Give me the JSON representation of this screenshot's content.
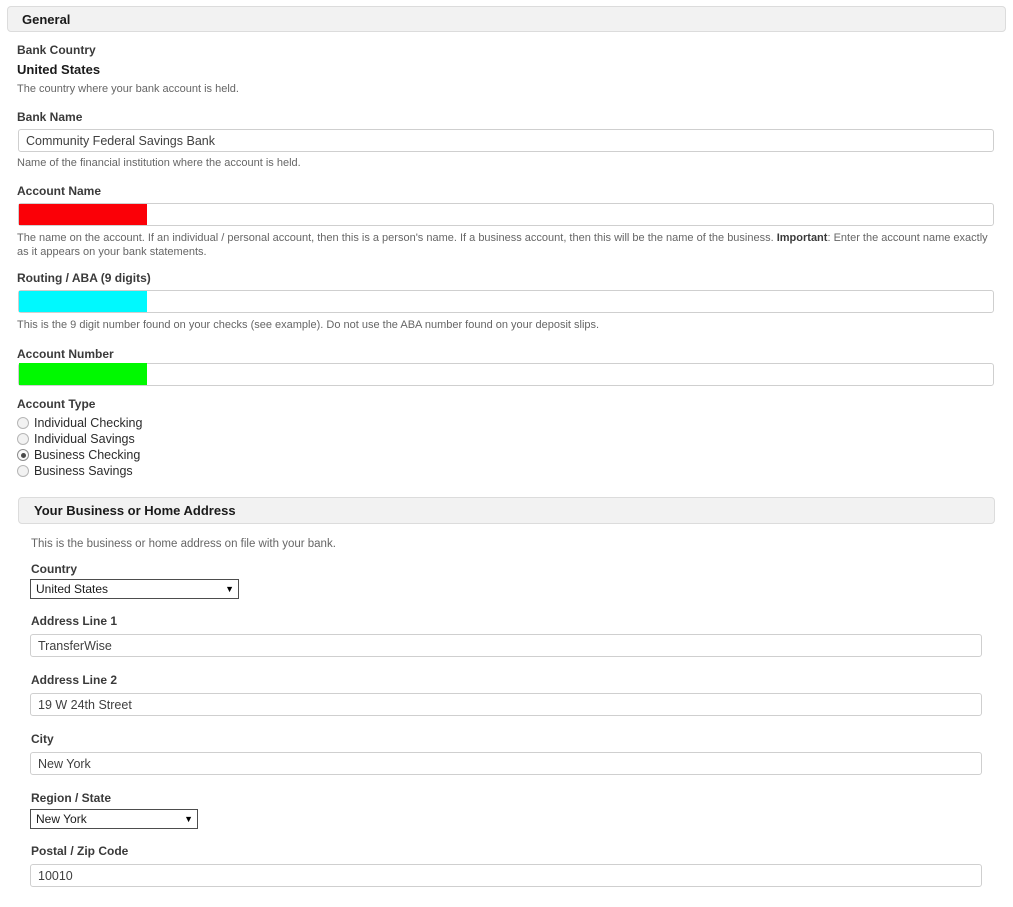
{
  "general_section": {
    "title": "General",
    "bank_country": {
      "label": "Bank Country",
      "value": "United States",
      "help": "The country where your bank account is held."
    },
    "bank_name": {
      "label": "Bank Name",
      "value": "Community Federal Savings Bank",
      "help": "Name of the financial institution where the account is held."
    },
    "account_name": {
      "label": "Account Name",
      "value": "",
      "redaction_color": "#fb0007",
      "help_part1": "The name on the account. If an individual / personal account, then this is a person's name. If a business account, then this will be the name of the business. ",
      "help_bold": "Important",
      "help_part2": ": Enter the account name exactly as it appears on your bank statements."
    },
    "routing_aba": {
      "label": "Routing / ABA (9 digits)",
      "value": "",
      "redaction_color": "#00f9fe",
      "help": "This is the 9 digit number found on your checks (see example). Do not use the ABA number found on your deposit slips."
    },
    "account_number": {
      "label": "Account Number",
      "value": "",
      "redaction_color": "#00f900"
    },
    "account_type": {
      "label": "Account Type",
      "options": [
        {
          "label": "Individual Checking",
          "selected": false
        },
        {
          "label": "Individual Savings",
          "selected": false
        },
        {
          "label": "Business Checking",
          "selected": true
        },
        {
          "label": "Business Savings",
          "selected": false
        }
      ]
    }
  },
  "address_section": {
    "title": "Your Business or Home Address",
    "intro": "This is the business or home address on file with your bank.",
    "country": {
      "label": "Country",
      "value": "United States",
      "arrow": "▼"
    },
    "address_line_1": {
      "label": "Address Line 1",
      "value": "TransferWise"
    },
    "address_line_2": {
      "label": "Address Line 2",
      "value": "19 W 24th Street"
    },
    "city": {
      "label": "City",
      "value": "New York"
    },
    "region_state": {
      "label": "Region / State",
      "value": "New York",
      "arrow": "▼"
    },
    "postal_zip": {
      "label": "Postal / Zip Code",
      "value": "10010"
    }
  }
}
